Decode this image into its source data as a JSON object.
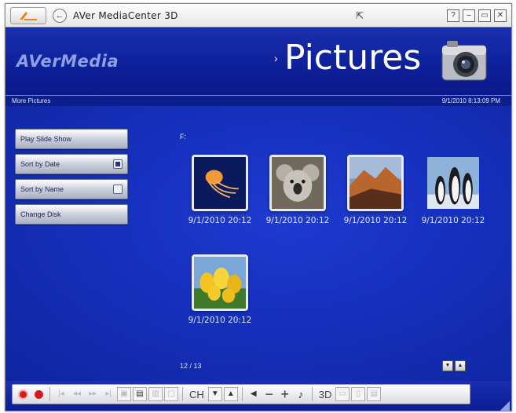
{
  "window": {
    "title": "AVer MediaCenter 3D",
    "controls": [
      "?",
      "–",
      "▭",
      "✕"
    ]
  },
  "header": {
    "logo": "AVerMedia",
    "title": "Pictures",
    "title_marker": "›"
  },
  "subbar": {
    "left": "More Pictures",
    "right": "9/1/2010 8:13:09 PM"
  },
  "menu": {
    "items": [
      {
        "label": "Play Slide Show",
        "checkbox": null
      },
      {
        "label": "Sort by Date",
        "checkbox": true
      },
      {
        "label": "Sort by Name",
        "checkbox": false
      },
      {
        "label": "Change Disk",
        "checkbox": null
      }
    ]
  },
  "gallery": {
    "drive": "F:",
    "thumbs": [
      {
        "kind": "jellyfish",
        "label": "9/1/2010 20:12"
      },
      {
        "kind": "koala",
        "label": "9/1/2010 20:12"
      },
      {
        "kind": "desert",
        "label": "9/1/2010 20:12"
      },
      {
        "kind": "penguins",
        "label": "9/1/2010 20:12"
      },
      {
        "kind": "tulips",
        "label": "9/1/2010 20:12"
      }
    ],
    "page_counter": "12 / 13",
    "pager": [
      "▼",
      "▲"
    ]
  },
  "toolbar": {
    "ch_label": "CH",
    "three_d_label": "3D"
  },
  "colors": {
    "accent": "#1530bd",
    "record": "#d41c1c"
  }
}
